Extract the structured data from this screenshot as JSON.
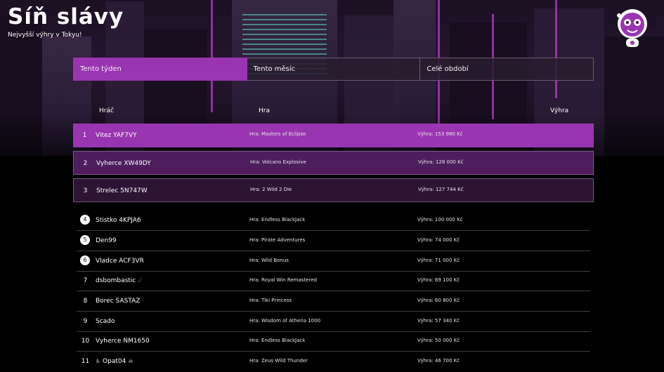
{
  "page": {
    "title": "Síň slávy",
    "subtitle": "Nejvyšší výhry v Tokyu!"
  },
  "tabs": [
    {
      "label": "Tento týden",
      "active": true
    },
    {
      "label": "Tento měsíc",
      "active": false
    },
    {
      "label": "Celé období",
      "active": false
    }
  ],
  "columns": {
    "player": "Hráč",
    "game": "Hra",
    "win": "Výhra"
  },
  "rows": [
    {
      "rank": "1",
      "name": "Vitez YAF7VY",
      "game": "Hra: Masters of Eclipse",
      "win": "Výhra: 153 980 Kč"
    },
    {
      "rank": "2",
      "name": "Vyherce XW49DY",
      "game": "Hra: Volcano Explosive",
      "win": "Výhra: 128 000 Kč"
    },
    {
      "rank": "3",
      "name": "Strelec 5N747W",
      "game": "Hra: 2 Wild 2 Die",
      "win": "Výhra: 127 744 Kč"
    },
    {
      "rank": "4",
      "name": "Stistko 4KPJA6",
      "game": "Hra: Endless BlackJack",
      "win": "Výhra: 100 000 Kč"
    },
    {
      "rank": "5",
      "name": "Den99",
      "game": "Hra: Pirate Adventures",
      "win": "Výhra: 74 000 Kč"
    },
    {
      "rank": "6",
      "name": "Vladce ACF3VR",
      "game": "Hra: Wild Bonus",
      "win": "Výhra: 71 000 Kč"
    },
    {
      "rank": "7",
      "name": "dsbombastic",
      "suffix": "☄",
      "game": "Hra: Royal Win Remastered",
      "win": "Výhra: 69 100 Kč"
    },
    {
      "rank": "8",
      "name": "Borec SASTAZ",
      "game": "Hra: Tiki Princess",
      "win": "Výhra: 60 800 Kč"
    },
    {
      "rank": "9",
      "name": "Scado",
      "game": "Hra: Wisdom of Athena 1000",
      "win": "Výhra: 57 340 Kč"
    },
    {
      "rank": "10",
      "name": "Vyherce NM1650",
      "game": "Hra: Endless BlackJack",
      "win": "Výhra: 50 000 Kč"
    },
    {
      "rank": "11",
      "prefix": "♿",
      "name": "Opat04",
      "suffix": "☠",
      "game": "Hra: Zeus Wild Thunder",
      "win": "Výhra: 46 700 Kč"
    }
  ],
  "icons": {
    "mascot": "astronaut-mascot-icon"
  },
  "colors": {
    "accent": "#9a35b1",
    "second": "#4d1d5d",
    "third": "#2b1434",
    "background": "#000000"
  }
}
